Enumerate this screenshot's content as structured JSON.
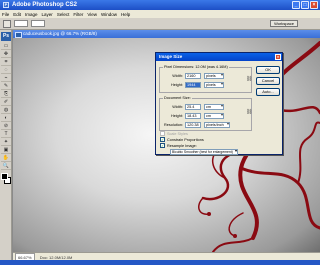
{
  "app": {
    "title": "Adobe Photoshop CS2",
    "icon": "photoshop-app-icon"
  },
  "window_controls": [
    "minimize-icon",
    "maximize-icon",
    "close-icon"
  ],
  "menu": [
    "File",
    "Edit",
    "Image",
    "Layer",
    "Select",
    "Filter",
    "View",
    "Window",
    "Help"
  ],
  "options_bar": {
    "workspace_label": "Workspace"
  },
  "toolbox": {
    "logo": "Ps",
    "tools": [
      "▭",
      "✥",
      "⌗",
      "◌",
      "⌁",
      "✎",
      "⎘",
      "✐",
      "◍",
      "◐",
      "⊘",
      "T",
      "✦",
      "▣",
      "✋",
      "🔍"
    ]
  },
  "document": {
    "title": "caduceusbook.jpg @ 66.7% (RGB/8)",
    "zoom": "66.67%",
    "status": "Doc: 12.0M/12.0M"
  },
  "dialog": {
    "title": "Image Size",
    "close_icon": "close-icon",
    "pixel_dimensions": {
      "legend": "Pixel Dimensions:  12.0M (was 4.16M)",
      "width_label": "Width:",
      "width_value": "2160",
      "width_unit": "pixels",
      "height_label": "Height:",
      "height_value": "1944",
      "height_unit": "pixels"
    },
    "document_size": {
      "legend": "Document Size:",
      "width_label": "Width:",
      "width_value": "25.4",
      "width_unit": "cm",
      "height_label": "Height:",
      "height_value": "18.43",
      "height_unit": "cm",
      "resolution_label": "Resolution:",
      "resolution_value": "120.38",
      "resolution_unit": "pixels/inch"
    },
    "scale_styles": {
      "label": "Scale Styles",
      "checked": false,
      "enabled": false
    },
    "constrain_proportions": {
      "label": "Constrain Proportions",
      "checked": true
    },
    "resample_image": {
      "label": "Resample Image:",
      "checked": true,
      "value": "Bicubic Smoother (best for enlargement)"
    },
    "buttons": {
      "ok": "OK",
      "cancel": "Cancel",
      "auto": "Auto..."
    }
  }
}
